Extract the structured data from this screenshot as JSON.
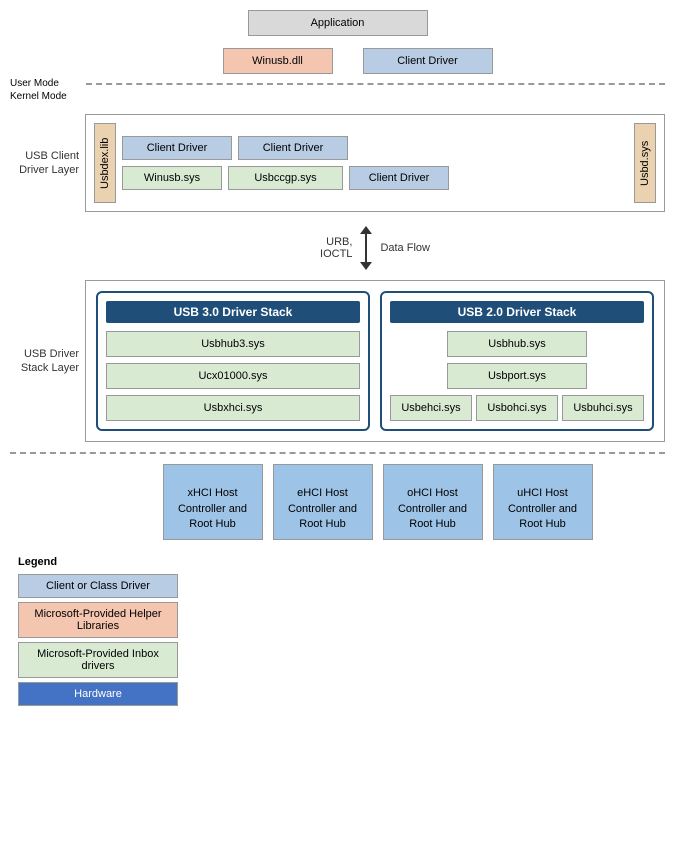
{
  "app": {
    "title": "Application"
  },
  "userMode": {
    "label": "User Mode",
    "winusb_dll": "Winusb.dll",
    "client_driver": "Client Driver"
  },
  "kernelMode": {
    "label": "Kernel Mode"
  },
  "clientDriverLayer": {
    "label": "USB Client Driver Layer",
    "usbdex_lib": "Usbdex.lib",
    "usbd_sys": "Usbd.sys",
    "client_driver1": "Client Driver",
    "client_driver2": "Client Driver",
    "winusb_sys": "Winusb.sys",
    "usbccgp_sys": "Usbccgp.sys",
    "client_driver3": "Client Driver"
  },
  "arrowSection": {
    "urb_ioctl": "URB,\nIOCTL",
    "data_flow": "Data Flow"
  },
  "usbDriverStackLayer": {
    "label": "USB Driver Stack Layer",
    "usb30": {
      "title": "USB 3.0 Driver Stack",
      "usbhub3": "Usbhub3.sys",
      "ucx01000": "Ucx01000.sys",
      "usbxhci": "Usbxhci.sys"
    },
    "usb20": {
      "title": "USB 2.0 Driver Stack",
      "usbhub": "Usbhub.sys",
      "usbport": "Usbport.sys",
      "usbehci": "Usbehci.sys",
      "usbohci": "Usbohci.sys",
      "usbuhci": "Usbuhci.sys"
    }
  },
  "hostControllers": {
    "xhci": "xHCI Host\nController and\nRoot Hub",
    "ehci": "eHCI Host\nController and\nRoot Hub",
    "ohci": "oHCI Host\nController and\nRoot Hub",
    "uhci": "uHCI Host\nController and\nRoot Hub"
  },
  "legend": {
    "title": "Legend",
    "items": [
      "Client or Class Driver",
      "Microsoft-Provided Helper Libraries",
      "Microsoft-Provided Inbox drivers",
      "Hardware"
    ]
  }
}
